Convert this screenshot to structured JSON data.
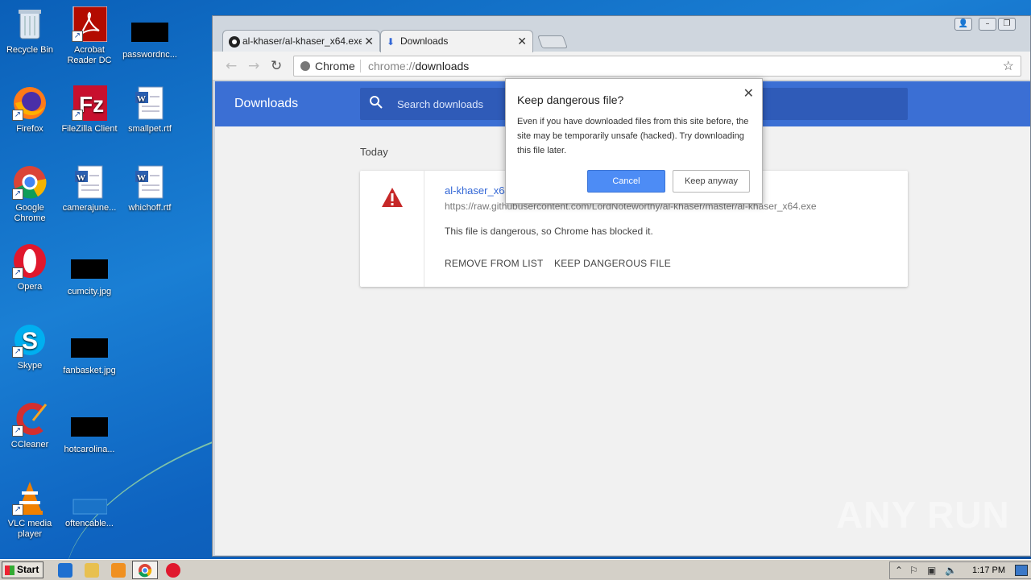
{
  "desktop": {
    "icons": [
      {
        "label": "Recycle Bin",
        "icon": "recycle-bin-icon"
      },
      {
        "label": "Acrobat Reader DC",
        "icon": "acrobat-icon"
      },
      {
        "label": "passwordnc...",
        "icon": "file-icon"
      },
      {
        "label": "Firefox",
        "icon": "firefox-icon"
      },
      {
        "label": "FileZilla Client",
        "icon": "filezilla-icon"
      },
      {
        "label": "smallpet.rtf",
        "icon": "word-doc-icon"
      },
      {
        "label": "Google Chrome",
        "icon": "chrome-icon"
      },
      {
        "label": "camerajune...",
        "icon": "word-doc-icon"
      },
      {
        "label": "whichoff.rtf",
        "icon": "word-doc-icon"
      },
      {
        "label": "Opera",
        "icon": "opera-icon"
      },
      {
        "label": "cumcity.jpg",
        "icon": "image-file-icon"
      },
      {
        "label": "Skype",
        "icon": "skype-icon"
      },
      {
        "label": "fanbasket.jpg",
        "icon": "image-file-icon"
      },
      {
        "label": "CCleaner",
        "icon": "ccleaner-icon"
      },
      {
        "label": "hotcarolina...",
        "icon": "image-file-icon"
      },
      {
        "label": "VLC media player",
        "icon": "vlc-icon"
      },
      {
        "label": "oftencable...",
        "icon": "file-icon"
      }
    ]
  },
  "browser": {
    "tabs": [
      {
        "label": "al-khaser/al-khaser_x64.exe",
        "icon": "github-icon"
      },
      {
        "label": "Downloads",
        "icon": "download-icon"
      }
    ],
    "omnibox": {
      "label": "Chrome",
      "url_prefix": "chrome://",
      "url_path": "downloads"
    },
    "downloads_page": {
      "title": "Downloads",
      "search_placeholder": "Search downloads",
      "section": "Today",
      "item": {
        "filename": "al-khaser_x64.exe",
        "url": "https://raw.githubusercontent.com/LordNoteworthy/al-khaser/master/al-khaser_x64.exe",
        "status": "This file is dangerous, so Chrome has blocked it.",
        "remove_label": "REMOVE FROM LIST",
        "keep_label": "KEEP DANGEROUS FILE"
      }
    },
    "dialog": {
      "title": "Keep dangerous file?",
      "body": "Even if you have downloaded files from this site before, the site may be temporarily unsafe (hacked). Try downloading this file later.",
      "cancel": "Cancel",
      "keep": "Keep anyway"
    }
  },
  "taskbar": {
    "start": "Start",
    "clock": "1:17 PM"
  },
  "watermark": "ANY RUN",
  "colors": {
    "accent": "#3b6fd4",
    "dialog_button": "#4d8cf5",
    "warning": "#c62828",
    "link": "#3367d6"
  }
}
